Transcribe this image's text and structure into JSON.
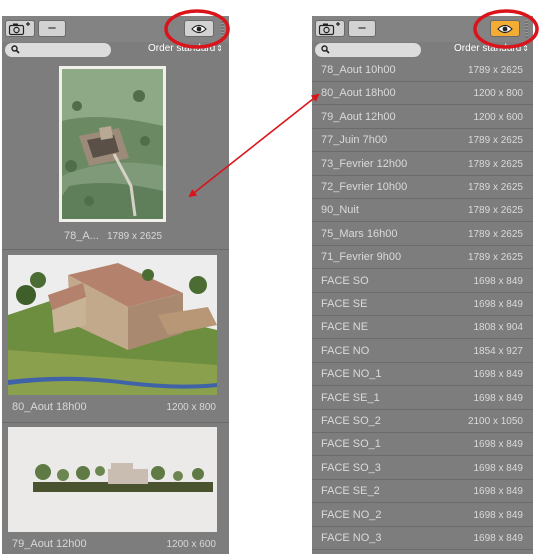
{
  "left_panel": {
    "order_label": "Order standard",
    "items": [
      {
        "name": "78_A...",
        "size": "1789 x 2625"
      },
      {
        "name": "80_Aout 18h00",
        "size": "1200 x 800"
      },
      {
        "name": "79_Aout 12h00",
        "size": "1200 x 600"
      }
    ]
  },
  "right_panel": {
    "order_label": "Order standard",
    "rows": [
      {
        "name": "78_Aout 10h00",
        "size": "1789 x 2625"
      },
      {
        "name": "80_Aout 18h00",
        "size": "1200 x 800"
      },
      {
        "name": "79_Aout 12h00",
        "size": "1200 x 600"
      },
      {
        "name": "77_Juin 7h00",
        "size": "1789 x 2625"
      },
      {
        "name": "73_Fevrier 12h00",
        "size": "1789 x 2625"
      },
      {
        "name": "72_Fevrier 10h00",
        "size": "1789 x 2625"
      },
      {
        "name": "90_Nuit",
        "size": "1789 x 2625"
      },
      {
        "name": "75_Mars 16h00",
        "size": "1789 x 2625"
      },
      {
        "name": "71_Fevrier 9h00",
        "size": "1789 x 2625"
      },
      {
        "name": "FACE SO",
        "size": "1698 x 849"
      },
      {
        "name": "FACE SE",
        "size": "1698 x 849"
      },
      {
        "name": "FACE NE",
        "size": "1808 x 904"
      },
      {
        "name": "FACE NO",
        "size": "1854 x 927"
      },
      {
        "name": "FACE NO_1",
        "size": "1698 x 849"
      },
      {
        "name": "FACE SE_1",
        "size": "1698 x 849"
      },
      {
        "name": "FACE SO_2",
        "size": "2100 x 1050"
      },
      {
        "name": "FACE SO_1",
        "size": "1698 x 849"
      },
      {
        "name": "FACE SO_3",
        "size": "1698 x 849"
      },
      {
        "name": "FACE SE_2",
        "size": "1698 x 849"
      },
      {
        "name": "FACE NO_2",
        "size": "1698 x 849"
      },
      {
        "name": "FACE NO_3",
        "size": "1698 x 849"
      }
    ]
  },
  "icons": {
    "add_snapshot": "camera-plus-icon",
    "remove": "minus-icon",
    "toggle_view": "eye-icon",
    "search": "magnifier-icon"
  },
  "colors": {
    "panel_bg": "#7d7d7d",
    "eye_active": "#f2ad32",
    "annotation_red": "#d9141b"
  }
}
